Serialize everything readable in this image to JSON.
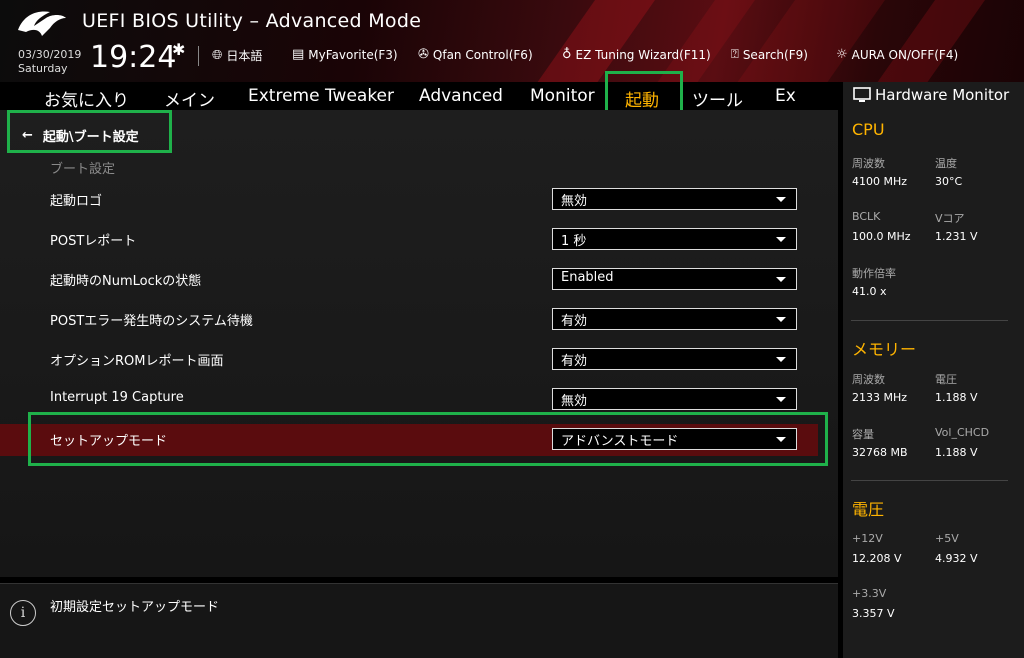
{
  "header": {
    "title": "UEFI BIOS Utility – Advanced Mode",
    "date": "03/30/2019",
    "day": "Saturday",
    "time": "19:24",
    "items": [
      {
        "label": "日本語",
        "icon": "globe-icon"
      },
      {
        "label": "MyFavorite(F3)",
        "icon": "favorite-list-icon"
      },
      {
        "label": "Qfan Control(F6)",
        "icon": "fan-icon"
      },
      {
        "label": "EZ Tuning Wizard(F11)",
        "icon": "lightbulb-icon"
      },
      {
        "label": "Search(F9)",
        "icon": "search-icon"
      },
      {
        "label": "AURA ON/OFF(F4)",
        "icon": "aura-icon"
      }
    ]
  },
  "tabs": [
    "お気に入り",
    "メイン",
    "Extreme Tweaker",
    "Advanced",
    "Monitor",
    "起動",
    "ツール",
    "Ex"
  ],
  "active_tab": "起動",
  "breadcrumb": "起動\\ブート設定",
  "section_title": "ブート設定",
  "settings": [
    {
      "label": "起動ロゴ",
      "value": "無効"
    },
    {
      "label": "POSTレポート",
      "value": "1 秒"
    },
    {
      "label": "起動時のNumLockの状態",
      "value": "Enabled"
    },
    {
      "label": "POSTエラー発生時のシステム待機",
      "value": "有効"
    },
    {
      "label": "オプションROMレポート画面",
      "value": "有効"
    },
    {
      "label": "Interrupt 19 Capture",
      "value": "無効"
    },
    {
      "label": "セットアップモード",
      "value": "アドバンストモード"
    }
  ],
  "help_text": "初期設定セットアップモード",
  "hardware_monitor": {
    "title": "Hardware Monitor",
    "cpu": {
      "title": "CPU",
      "freq_label": "周波数",
      "freq_value": "4100 MHz",
      "temp_label": "温度",
      "temp_value": "30°C",
      "bclk_label": "BCLK",
      "bclk_value": "100.0 MHz",
      "vcore_label": "Vコア",
      "vcore_value": "1.231 V",
      "ratio_label": "動作倍率",
      "ratio_value": "41.0 x"
    },
    "memory": {
      "title": "メモリー",
      "freq_label": "周波数",
      "freq_value": "2133 MHz",
      "volt_label": "電圧",
      "volt_value": "1.188 V",
      "cap_label": "容量",
      "cap_value": "32768 MB",
      "chcd_label": "Vol_CHCD",
      "chcd_value": "1.188 V"
    },
    "voltage": {
      "title": "電圧",
      "v12_label": "+12V",
      "v12_value": "12.208 V",
      "v5_label": "+5V",
      "v5_value": "4.932 V",
      "v33_label": "+3.3V",
      "v33_value": "3.357 V"
    }
  },
  "colors": {
    "accent": "#ffb400",
    "highlight_row": "#5a0c0e",
    "annotation_box": "#1fb14a"
  }
}
